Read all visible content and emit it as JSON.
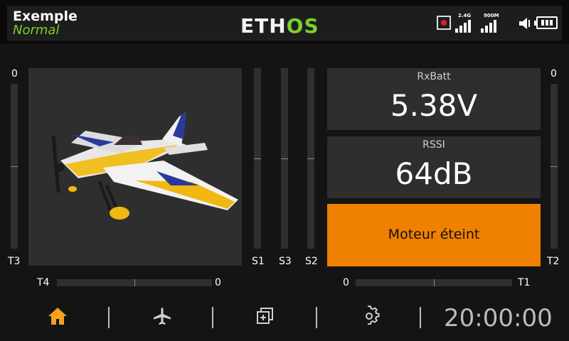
{
  "header": {
    "model_name": "Exemple",
    "flight_mode": "Normal",
    "logo_main": "ETH",
    "logo_accent": "OS",
    "rx1_label": "2.4G",
    "rx2_label": "900M",
    "icons": [
      "record-icon",
      "signal-bars-icon",
      "speaker-icon",
      "battery-icon"
    ]
  },
  "trims": {
    "left_vertical": {
      "label": "T3",
      "top_value": "0"
    },
    "right_vertical": {
      "label": "T2",
      "top_value": "0"
    },
    "left_horizontal": {
      "label": "T4",
      "value": "0"
    },
    "right_horizontal": {
      "label": "T1",
      "value": "0"
    }
  },
  "sliders": [
    {
      "label": "S1"
    },
    {
      "label": "S3"
    },
    {
      "label": "S2"
    }
  ],
  "widgets": {
    "rxbatt": {
      "title": "RxBatt",
      "value": "5.38V"
    },
    "rssi": {
      "title": "RSSI",
      "value": "64dB"
    },
    "motor": {
      "label": "Moteur éteint"
    }
  },
  "navbar": {
    "icons": [
      "home-icon",
      "airplane-icon",
      "screens-icon",
      "gear-icon"
    ],
    "timer": "20:00:00"
  },
  "colors": {
    "accent_green": "#7ccf2e",
    "accent_orange": "#f08000",
    "panel": "#2e2e2e",
    "background": "#141414"
  }
}
